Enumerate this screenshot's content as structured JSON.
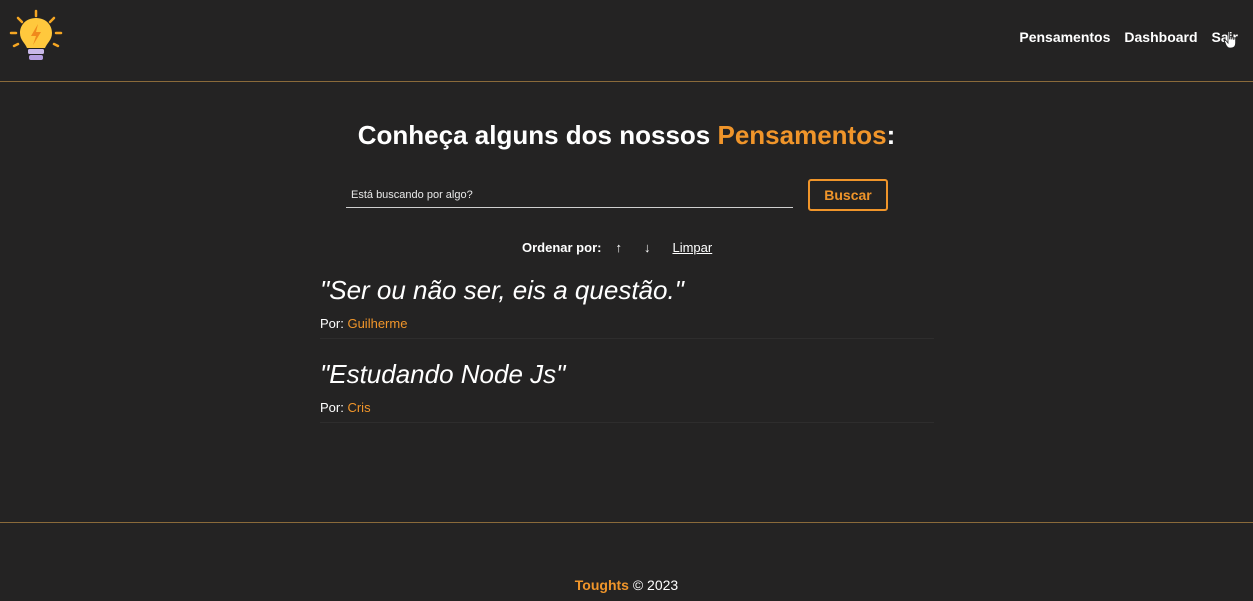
{
  "nav": {
    "links": [
      "Pensamentos",
      "Dashboard",
      "Sair"
    ]
  },
  "page": {
    "title_prefix": "Conheça alguns dos nossos ",
    "title_accent": "Pensamentos",
    "title_suffix": ":"
  },
  "search": {
    "placeholder": "Está buscando por algo?",
    "button_label": "Buscar"
  },
  "order": {
    "label": "Ordenar por:",
    "asc": "↑",
    "desc": "↓",
    "clear": "Limpar"
  },
  "thoughts": [
    {
      "quote": "\"Ser ou não ser, eis a questão.\"",
      "by_label": "Por: ",
      "author": "Guilherme"
    },
    {
      "quote": "\"Estudando Node Js\"",
      "by_label": "Por: ",
      "author": "Cris"
    }
  ],
  "footer": {
    "brand": "Toughts",
    "copyright": " © 2023"
  },
  "colors": {
    "background": "#242323",
    "accent": "#f0952a",
    "divider": "#8a6a3a"
  },
  "icons": {
    "logo": "lightbulb-icon",
    "cursor": "hand-pointer-icon"
  }
}
